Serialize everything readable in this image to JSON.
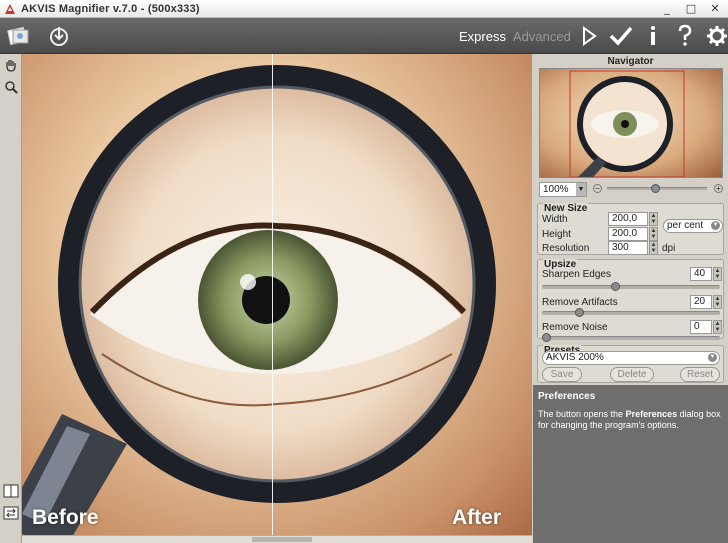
{
  "window": {
    "title": "AKVIS Magnifier v.7.0 -  (500x333)"
  },
  "toolbar": {
    "modes": {
      "express": "Express",
      "advanced": "Advanced"
    },
    "icons": [
      "open-icon",
      "save-icon",
      "run-icon",
      "apply-icon",
      "info-icon",
      "help-icon",
      "settings-icon"
    ]
  },
  "canvas": {
    "before_label": "Before",
    "after_label": "After"
  },
  "navigator": {
    "title": "Navigator",
    "zoom": "100%"
  },
  "new_size": {
    "title": "New Size",
    "width_label": "Width",
    "width_value": "200,0",
    "height_label": "Height",
    "height_value": "200,0",
    "unit": "per cent",
    "resolution_label": "Resolution",
    "resolution_value": "300",
    "resolution_unit": "dpi"
  },
  "upsize": {
    "title": "Upsize",
    "sharpen_label": "Sharpen Edges",
    "sharpen_value": "40",
    "artifacts_label": "Remove Artifacts",
    "artifacts_value": "20",
    "noise_label": "Remove Noise",
    "noise_value": "0"
  },
  "presets": {
    "title": "Presets",
    "selected": "AKVIS 200%",
    "save": "Save",
    "delete": "Delete",
    "reset": "Reset"
  },
  "help": {
    "title": "Preferences",
    "text_pre": "The button opens the ",
    "text_bold": "Preferences",
    "text_post": " dialog box for changing the program's options."
  }
}
